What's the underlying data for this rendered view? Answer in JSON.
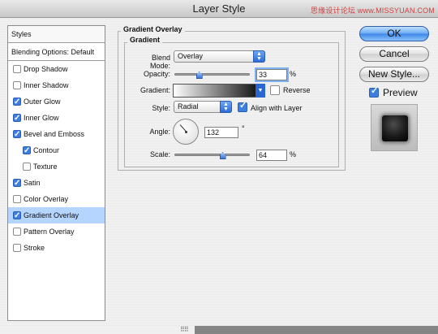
{
  "window": {
    "title": "Layer Style",
    "watermark": "思缘设计论坛 www.MISSYUAN.COM"
  },
  "sidebar": {
    "header": "Styles",
    "blending_options": "Blending Options: Default",
    "items": [
      {
        "label": "Drop Shadow",
        "checked": false,
        "indent": false,
        "selected": false
      },
      {
        "label": "Inner Shadow",
        "checked": false,
        "indent": false,
        "selected": false
      },
      {
        "label": "Outer Glow",
        "checked": true,
        "indent": false,
        "selected": false
      },
      {
        "label": "Inner Glow",
        "checked": true,
        "indent": false,
        "selected": false
      },
      {
        "label": "Bevel and Emboss",
        "checked": true,
        "indent": false,
        "selected": false
      },
      {
        "label": "Contour",
        "checked": true,
        "indent": true,
        "selected": false
      },
      {
        "label": "Texture",
        "checked": false,
        "indent": true,
        "selected": false
      },
      {
        "label": "Satin",
        "checked": true,
        "indent": false,
        "selected": false
      },
      {
        "label": "Color Overlay",
        "checked": false,
        "indent": false,
        "selected": false
      },
      {
        "label": "Gradient Overlay",
        "checked": true,
        "indent": false,
        "selected": true
      },
      {
        "label": "Pattern Overlay",
        "checked": false,
        "indent": false,
        "selected": false
      },
      {
        "label": "Stroke",
        "checked": false,
        "indent": false,
        "selected": false
      }
    ]
  },
  "panel": {
    "group_title": "Gradient Overlay",
    "sub_title": "Gradient",
    "blend_mode": {
      "label": "Blend Mode:",
      "value": "Overlay"
    },
    "opacity": {
      "label": "Opacity:",
      "value": "33",
      "unit": "%",
      "level": 33
    },
    "gradient": {
      "label": "Gradient:",
      "reverse_label": "Reverse",
      "reverse_checked": false
    },
    "style": {
      "label": "Style:",
      "value": "Radial",
      "align_label": "Align with Layer",
      "align_checked": true
    },
    "angle": {
      "label": "Angle:",
      "value": "132",
      "unit": "°"
    },
    "scale": {
      "label": "Scale:",
      "value": "64",
      "unit": "%",
      "level": 64
    }
  },
  "buttons": {
    "ok": "OK",
    "cancel": "Cancel",
    "new_style": "New Style..."
  },
  "preview": {
    "label": "Preview",
    "checked": true
  },
  "colors": {
    "accent": "#3e7ee0",
    "selection": "#b5d5ff"
  }
}
